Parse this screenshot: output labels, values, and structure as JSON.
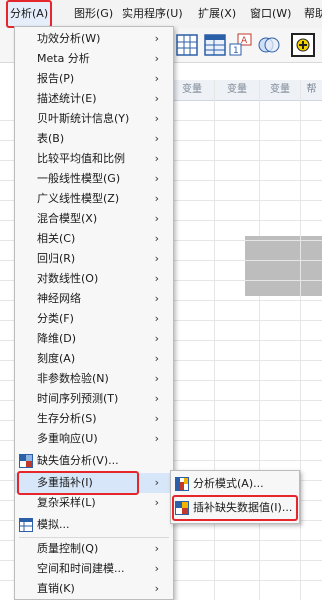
{
  "menubar": {
    "items": [
      {
        "label": "分析(A)",
        "active": true
      },
      {
        "label": "图形(G)"
      },
      {
        "label": "实用程序(U)"
      },
      {
        "label": "扩展(X)"
      },
      {
        "label": "窗口(W)"
      },
      {
        "label": "帮助"
      }
    ]
  },
  "grid": {
    "col_headers": [
      "变量",
      "变量",
      "变量",
      "帮"
    ]
  },
  "menu": {
    "items": [
      {
        "label": "功效分析(W)",
        "submenu": true
      },
      {
        "label": "Meta 分析",
        "submenu": true
      },
      {
        "label": "报告(P)",
        "submenu": true
      },
      {
        "label": "描述统计(E)",
        "submenu": true
      },
      {
        "label": "贝叶斯统计信息(Y)",
        "submenu": true
      },
      {
        "label": "表(B)",
        "submenu": true
      },
      {
        "label": "比较平均值和比例",
        "submenu": true
      },
      {
        "label": "一般线性模型(G)",
        "submenu": true
      },
      {
        "label": "广义线性模型(Z)",
        "submenu": true
      },
      {
        "label": "混合模型(X)",
        "submenu": true
      },
      {
        "label": "相关(C)",
        "submenu": true
      },
      {
        "label": "回归(R)",
        "submenu": true
      },
      {
        "label": "对数线性(O)",
        "submenu": true
      },
      {
        "label": "神经网络",
        "submenu": true
      },
      {
        "label": "分类(F)",
        "submenu": true
      },
      {
        "label": "降维(D)",
        "submenu": true
      },
      {
        "label": "刻度(A)",
        "submenu": true
      },
      {
        "label": "非参数检验(N)",
        "submenu": true
      },
      {
        "label": "时间序列预测(T)",
        "submenu": true
      },
      {
        "label": "生存分析(S)",
        "submenu": true
      },
      {
        "label": "多重响应(U)",
        "submenu": true
      },
      {
        "label": "缺失值分析(V)...",
        "submenu": false,
        "icon": "missing-value-icon"
      },
      {
        "label": "多重插补(I)",
        "submenu": true,
        "highlighted": true
      },
      {
        "label": "复杂采样(L)",
        "submenu": true
      },
      {
        "label": "模拟...",
        "submenu": false,
        "icon": "simulation-icon"
      },
      {
        "label": "质量控制(Q)",
        "submenu": true
      },
      {
        "label": "空间和时间建模...",
        "submenu": true
      },
      {
        "label": "直销(K)",
        "submenu": true
      }
    ]
  },
  "submenu": {
    "items": [
      {
        "label": "分析模式(A)...",
        "icon": "analyze-patterns-icon"
      },
      {
        "label": "插补缺失数据值(I)...",
        "icon": "impute-icon"
      }
    ]
  }
}
